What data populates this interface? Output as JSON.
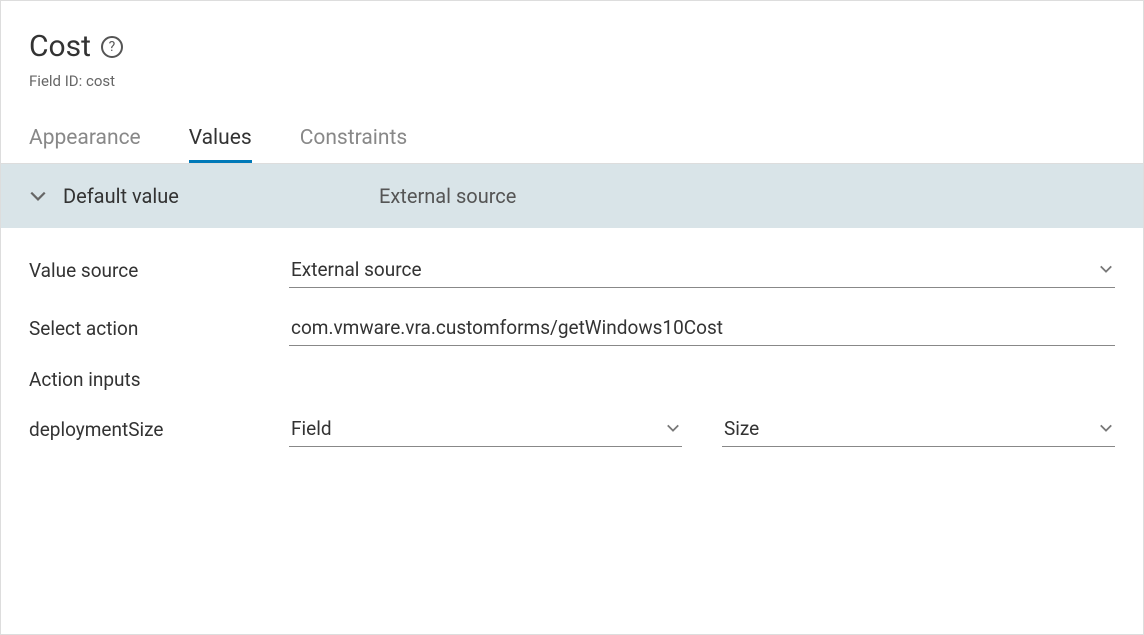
{
  "header": {
    "title": "Cost",
    "field_id_label": "Field ID: cost"
  },
  "tabs": {
    "appearance": "Appearance",
    "values": "Values",
    "constraints": "Constraints"
  },
  "section": {
    "label": "Default value",
    "value": "External source"
  },
  "form": {
    "value_source": {
      "label": "Value source",
      "value": "External source"
    },
    "select_action": {
      "label": "Select action",
      "value": "com.vmware.vra.customforms/getWindows10Cost"
    },
    "action_inputs_label": "Action inputs",
    "deployment_size": {
      "label": "deploymentSize",
      "type": "Field",
      "field": "Size"
    }
  }
}
